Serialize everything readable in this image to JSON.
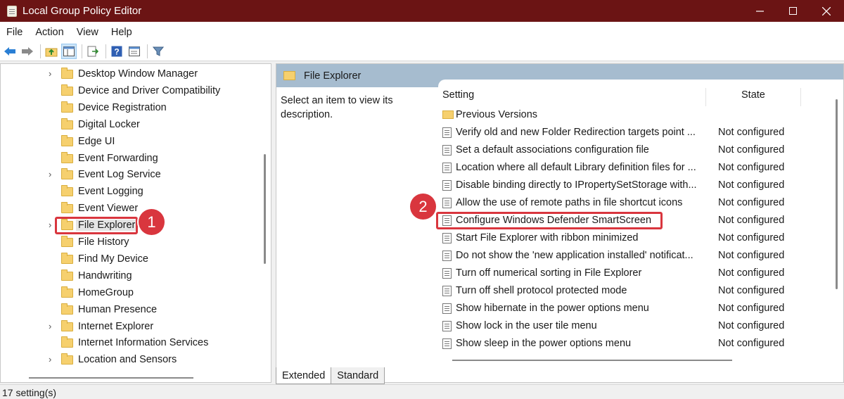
{
  "window": {
    "title": "Local Group Policy Editor"
  },
  "menu": [
    "File",
    "Action",
    "View",
    "Help"
  ],
  "toolbar": {
    "icons": [
      "back-arrow-icon",
      "forward-arrow-icon",
      "up-folder-icon",
      "show-hide-tree-icon",
      "export-list-icon",
      "help-icon",
      "properties-icon",
      "filter-icon"
    ]
  },
  "tree": {
    "items": [
      {
        "label": "Desktop Window Manager",
        "expandable": true
      },
      {
        "label": "Device and Driver Compatibility",
        "expandable": false
      },
      {
        "label": "Device Registration",
        "expandable": false
      },
      {
        "label": "Digital Locker",
        "expandable": false
      },
      {
        "label": "Edge UI",
        "expandable": false
      },
      {
        "label": "Event Forwarding",
        "expandable": false
      },
      {
        "label": "Event Log Service",
        "expandable": true
      },
      {
        "label": "Event Logging",
        "expandable": false
      },
      {
        "label": "Event Viewer",
        "expandable": false
      },
      {
        "label": "File Explorer",
        "expandable": true,
        "selected": true
      },
      {
        "label": "File History",
        "expandable": false
      },
      {
        "label": "Find My Device",
        "expandable": false
      },
      {
        "label": "Handwriting",
        "expandable": false
      },
      {
        "label": "HomeGroup",
        "expandable": false
      },
      {
        "label": "Human Presence",
        "expandable": false
      },
      {
        "label": "Internet Explorer",
        "expandable": true
      },
      {
        "label": "Internet Information Services",
        "expandable": false
      },
      {
        "label": "Location and Sensors",
        "expandable": true
      }
    ]
  },
  "callouts": {
    "one": "1",
    "two": "2"
  },
  "details": {
    "header": "File Explorer",
    "description": "Select an item to view its description.",
    "columns": {
      "setting": "Setting",
      "state": "State"
    },
    "rows": [
      {
        "name": "Previous Versions",
        "state": "",
        "type": "folder"
      },
      {
        "name": "Verify old and new Folder Redirection targets point ...",
        "state": "Not configured",
        "type": "policy"
      },
      {
        "name": "Set a default associations configuration file",
        "state": "Not configured",
        "type": "policy"
      },
      {
        "name": "Location where all default Library definition files for ...",
        "state": "Not configured",
        "type": "policy"
      },
      {
        "name": "Disable binding directly to IPropertySetStorage with...",
        "state": "Not configured",
        "type": "policy"
      },
      {
        "name": "Allow the use of remote paths in file shortcut icons",
        "state": "Not configured",
        "type": "policy"
      },
      {
        "name": "Configure Windows Defender SmartScreen",
        "state": "Not configured",
        "type": "policy",
        "highlighted": true
      },
      {
        "name": "Start File Explorer with ribbon minimized",
        "state": "Not configured",
        "type": "policy"
      },
      {
        "name": "Do not show the 'new application installed' notificat...",
        "state": "Not configured",
        "type": "policy"
      },
      {
        "name": "Turn off numerical sorting in File Explorer",
        "state": "Not configured",
        "type": "policy"
      },
      {
        "name": "Turn off shell protocol protected mode",
        "state": "Not configured",
        "type": "policy"
      },
      {
        "name": "Show hibernate in the power options menu",
        "state": "Not configured",
        "type": "policy"
      },
      {
        "name": "Show lock in the user tile menu",
        "state": "Not configured",
        "type": "policy"
      },
      {
        "name": "Show sleep in the power options menu",
        "state": "Not configured",
        "type": "policy"
      }
    ]
  },
  "tabs": [
    "Extended",
    "Standard"
  ],
  "status": "17 setting(s)",
  "colors": {
    "titlebar": "#6b1414",
    "callout": "#d9363e",
    "pane_header": "#a6bccf"
  }
}
